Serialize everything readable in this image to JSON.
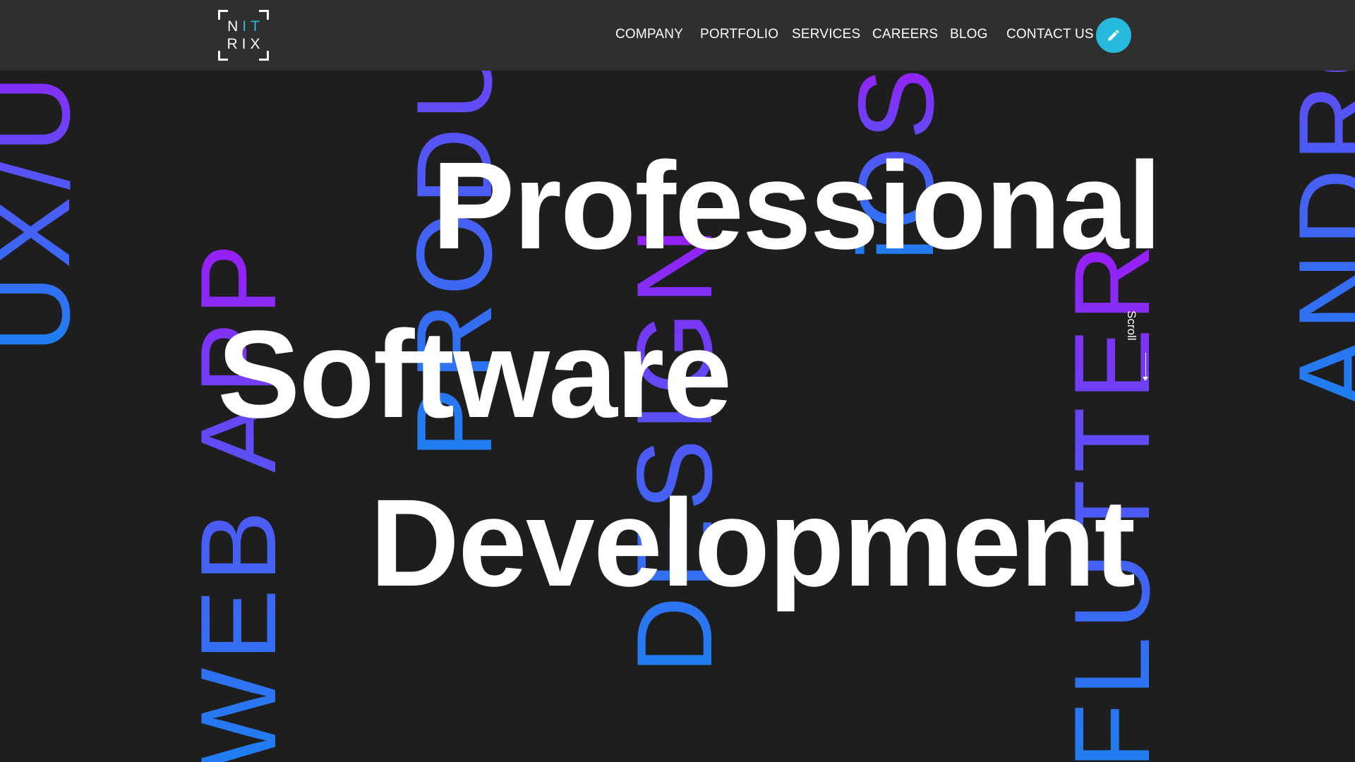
{
  "header": {
    "logo": {
      "row1": [
        "N",
        "I",
        "T"
      ],
      "row2": "RIX"
    },
    "nav": [
      {
        "label": "COMPANY"
      },
      {
        "label": "PORTFOLIO"
      },
      {
        "label": "SERVICES"
      },
      {
        "label": "CAREERS"
      },
      {
        "label": "BLOG"
      },
      {
        "label": "CONTACT US"
      }
    ],
    "edit_icon": "pencil-icon"
  },
  "hero": {
    "headline": [
      "Professional",
      "Software",
      "Development"
    ],
    "background_words": [
      "UX/UI",
      "WEB APP",
      "PRODUCT",
      "DESIGN",
      "iOS",
      "FLUTTER",
      "ANDROID"
    ],
    "scroll_label": "Scroll"
  },
  "colors": {
    "background": "#1e1e1f",
    "header": "#2f2f30",
    "accent": "#27b9dc",
    "gradient_start": "#1e7ff0",
    "gradient_end": "#9b1cf7"
  }
}
